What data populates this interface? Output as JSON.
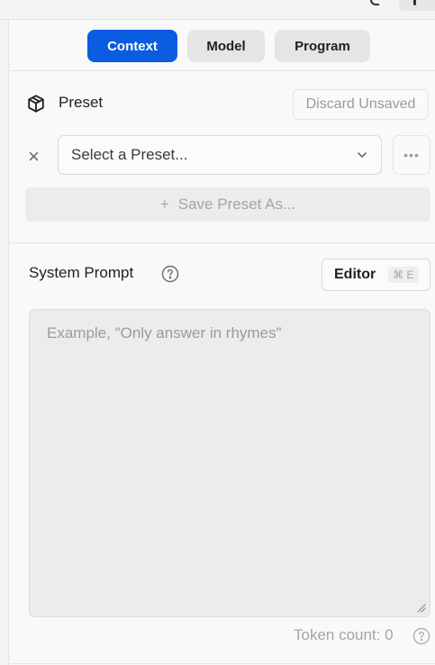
{
  "tabs": [
    {
      "label": "Context",
      "active": true
    },
    {
      "label": "Model",
      "active": false
    },
    {
      "label": "Program",
      "active": false
    }
  ],
  "preset": {
    "icon": "cube-icon",
    "label": "Preset",
    "discard_label": "Discard Unsaved",
    "clear_icon": "close-icon",
    "select_placeholder": "Select a Preset...",
    "more_label": "•••",
    "save_plus": "+",
    "save_label": "Save Preset As..."
  },
  "system_prompt": {
    "label": "System Prompt",
    "help_icon": "help-circle-icon",
    "editor_label": "Editor",
    "editor_shortcut": "⌘ E",
    "placeholder": "Example, \"Only answer in rhymes\"",
    "token_count_label": "Token count: 0"
  },
  "colors": {
    "accent": "#0a5ce1",
    "panel_bg": "#f9f9fa",
    "border": "#e4e4e7"
  }
}
